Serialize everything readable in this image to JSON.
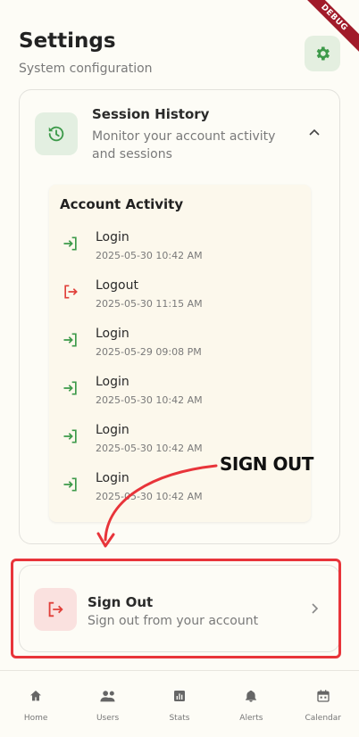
{
  "header": {
    "title": "Settings",
    "subtitle": "System configuration",
    "settings_icon": "gear-icon"
  },
  "debug_banner": "DEBUG",
  "session_history": {
    "title": "Session History",
    "description": "Monitor your account activity and sessions",
    "icon": "history-icon",
    "expanded": true
  },
  "account_activity": {
    "title": "Account Activity",
    "items": [
      {
        "type": "login",
        "label": "Login",
        "time": "2025-05-30 10:42 AM"
      },
      {
        "type": "logout",
        "label": "Logout",
        "time": "2025-05-30 11:15 AM"
      },
      {
        "type": "login",
        "label": "Login",
        "time": "2025-05-29 09:08 PM"
      },
      {
        "type": "login",
        "label": "Login",
        "time": "2025-05-30 10:42 AM"
      },
      {
        "type": "login",
        "label": "Login",
        "time": "2025-05-30 10:42 AM"
      },
      {
        "type": "login",
        "label": "Login",
        "time": "2025-05-30 10:42 AM"
      }
    ]
  },
  "sign_out": {
    "title": "Sign Out",
    "description": "Sign out from your account"
  },
  "annotation": {
    "label": "SIGN OUT",
    "color": "#e8343a"
  },
  "bottom_nav": [
    {
      "label": "Home",
      "icon": "home-icon"
    },
    {
      "label": "Users",
      "icon": "users-icon"
    },
    {
      "label": "Stats",
      "icon": "stats-icon"
    },
    {
      "label": "Alerts",
      "icon": "bell-icon"
    },
    {
      "label": "Calendar",
      "icon": "calendar-icon"
    }
  ],
  "colors": {
    "accent_green": "#3d9a4a",
    "danger_red": "#e0403a",
    "background": "#fdfcf6"
  }
}
